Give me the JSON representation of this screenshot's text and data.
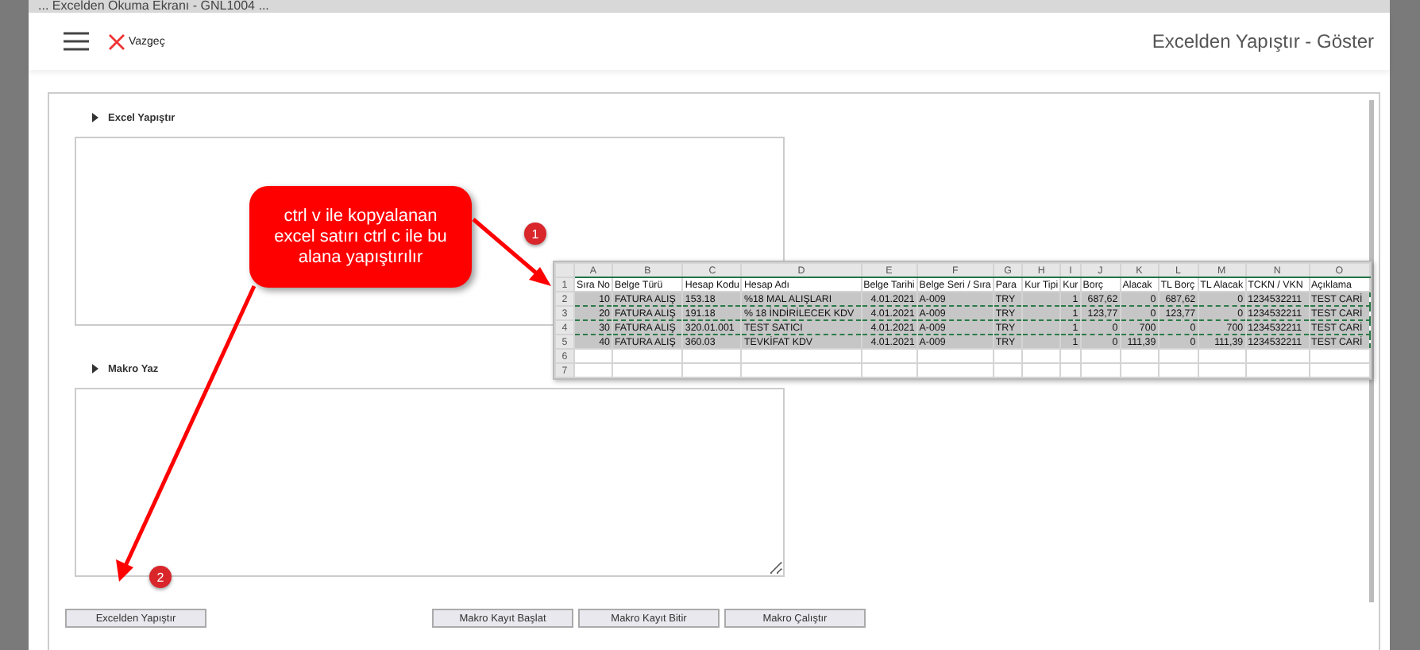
{
  "window": {
    "title": "... Excelden Okuma Ekranı - GNL1004 ..."
  },
  "header": {
    "cancel": "Vazgeç",
    "title": "Excelden Yapıştır - Göster"
  },
  "sections": [
    {
      "title": "Excel Yapıştır"
    },
    {
      "title": "Makro Yaz"
    }
  ],
  "buttons": {
    "left": "Excelden Yapıştır",
    "right": [
      "Makro Kayıt Başlat",
      "Makro Kayıt Bitir",
      "Makro Çalıştır"
    ]
  },
  "callout": {
    "text": "ctrl v ile kopyalanan excel satırı ctrl c ile bu alana yapıştırılır"
  },
  "steps": [
    "1",
    "2"
  ],
  "sheet": {
    "row_numbers": [
      "1",
      "2",
      "3",
      "4",
      "5",
      "6",
      "7"
    ],
    "columns": [
      {
        "letter": "A",
        "header": "Sıra No",
        "numeric": true
      },
      {
        "letter": "B",
        "header": "Belge Türü",
        "numeric": false
      },
      {
        "letter": "C",
        "header": "Hesap Kodu",
        "numeric": false
      },
      {
        "letter": "D",
        "header": "Hesap Adı",
        "numeric": false
      },
      {
        "letter": "E",
        "header": "Belge Tarihi",
        "numeric": true
      },
      {
        "letter": "F",
        "header": "Belge Seri / Sıra",
        "numeric": false
      },
      {
        "letter": "G",
        "header": "Para",
        "numeric": false
      },
      {
        "letter": "H",
        "header": "Kur Tipi"
      },
      {
        "letter": "I",
        "header": "Kur",
        "numeric": true
      },
      {
        "letter": "J",
        "header": "Borç",
        "numeric": true
      },
      {
        "letter": "K",
        "header": "Alacak",
        "numeric": true
      },
      {
        "letter": "L",
        "header": "TL Borç",
        "numeric": true
      },
      {
        "letter": "M",
        "header": "TL Alacak",
        "numeric": true
      },
      {
        "letter": "N",
        "header": "TCKN / VKN",
        "numeric": false
      },
      {
        "letter": "O",
        "header": "Açıklama",
        "numeric": false
      }
    ],
    "rows": [
      {
        "selected": true,
        "cells": [
          "10",
          "FATURA ALIŞ",
          "153.18",
          "%18 MAL ALIŞLARI",
          "4.01.2021",
          "A-009",
          "TRY",
          "",
          "1",
          "687,62",
          "0",
          "687,62",
          "0",
          "1234532211",
          "TEST CARİ"
        ]
      },
      {
        "selected": true,
        "cells": [
          "20",
          "FATURA ALIŞ",
          "191.18",
          "% 18 İNDİRİLECEK KDV",
          "4.01.2021",
          "A-009",
          "TRY",
          "",
          "1",
          "123,77",
          "0",
          "123,77",
          "0",
          "1234532211",
          "TEST CARİ"
        ]
      },
      {
        "selected": true,
        "cells": [
          "30",
          "FATURA ALIŞ",
          "320.01.001",
          "TEST SATICI",
          "4.01.2021",
          "A-009",
          "TRY",
          "",
          "1",
          "0",
          "700",
          "0",
          "700",
          "1234532211",
          "TEST CARİ"
        ]
      },
      {
        "selected": true,
        "cells": [
          "40",
          "FATURA ALIŞ",
          "360.03",
          "TEVKİFAT KDV",
          "4.01.2021",
          "A-009",
          "TRY",
          "",
          "1",
          "0",
          "111,39",
          "0",
          "111,39",
          "1234532211",
          "TEST CARİ"
        ]
      }
    ]
  }
}
